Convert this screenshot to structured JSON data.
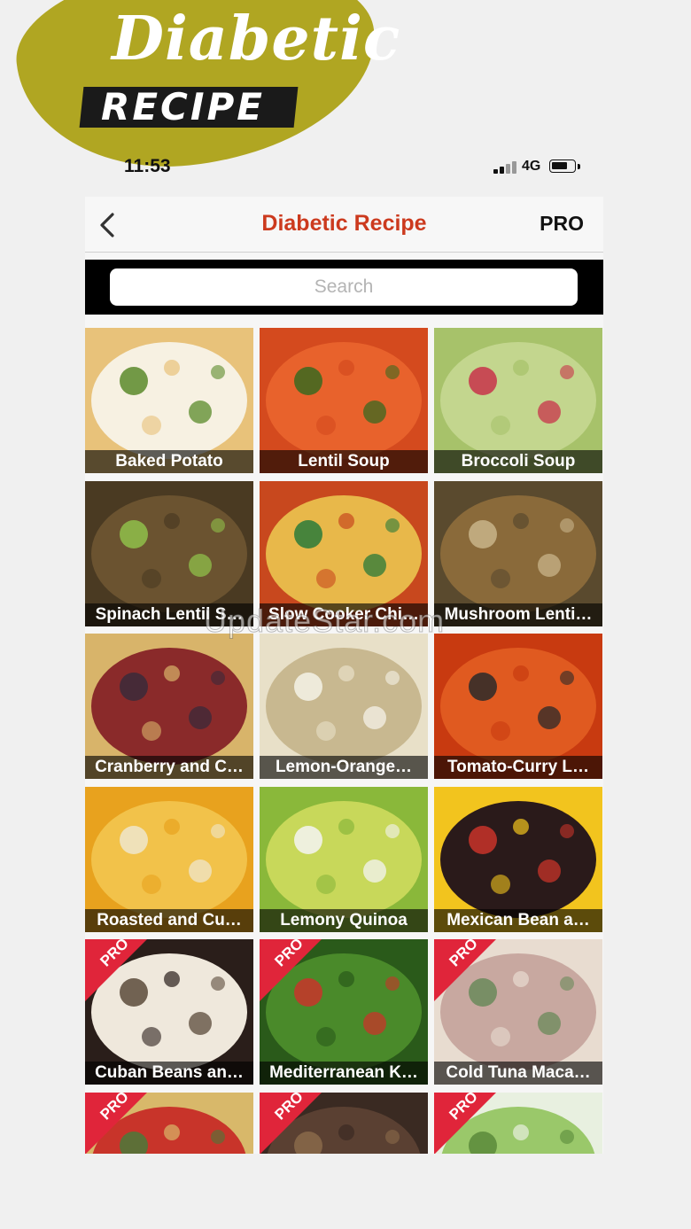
{
  "promo": {
    "script_word": "Diabetic",
    "bar_word": "RECIPE"
  },
  "status_bar": {
    "time": "11:53",
    "network": "4G"
  },
  "navbar": {
    "title": "Diabetic Recipe",
    "pro_label": "PRO"
  },
  "search": {
    "placeholder": "Search"
  },
  "pro_badge_text": "PRO",
  "watermark": "UpdateStar.com",
  "recipes": [
    {
      "label": "Baked Potato",
      "pro": false,
      "colors": [
        "#e8c27a",
        "#f7f1e2",
        "#5a8a2a"
      ]
    },
    {
      "label": "Lentil Soup",
      "pro": false,
      "colors": [
        "#d44a1e",
        "#e8622c",
        "#3a6a20"
      ]
    },
    {
      "label": "Broccoli Soup",
      "pro": false,
      "colors": [
        "#a7c26a",
        "#c3d68e",
        "#c8334a"
      ]
    },
    {
      "label": "Spinach Lentil S…",
      "pro": false,
      "colors": [
        "#4a3a22",
        "#6b5330",
        "#8fbf4a"
      ]
    },
    {
      "label": "Slow Cooker Chi…",
      "pro": false,
      "colors": [
        "#c8481e",
        "#e8b84a",
        "#2a7a3a"
      ]
    },
    {
      "label": "Mushroom Lenti…",
      "pro": false,
      "colors": [
        "#5a4a2e",
        "#8a6a3a",
        "#c8b48a"
      ]
    },
    {
      "label": "Cranberry and C…",
      "pro": false,
      "colors": [
        "#d8b46a",
        "#8a2a2a",
        "#3a2a3a"
      ]
    },
    {
      "label": "Lemon-Orange…",
      "pro": false,
      "colors": [
        "#e8e0c8",
        "#c8b890",
        "#f5f2e8"
      ]
    },
    {
      "label": "Tomato-Curry L…",
      "pro": false,
      "colors": [
        "#c83a10",
        "#e05a20",
        "#2a2a2a"
      ]
    },
    {
      "label": "Roasted and Cu…",
      "pro": false,
      "colors": [
        "#e8a21e",
        "#f2c24a",
        "#efe6cc"
      ]
    },
    {
      "label": "Lemony Quinoa",
      "pro": false,
      "colors": [
        "#8ab83a",
        "#c8d85a",
        "#f4f4f4"
      ]
    },
    {
      "label": "Mexican Bean a…",
      "pro": false,
      "colors": [
        "#f2c41e",
        "#2a1a1a",
        "#c8342a"
      ]
    },
    {
      "label": "Cuban Beans an…",
      "pro": true,
      "colors": [
        "#2a1e1a",
        "#efe8dc",
        "#5a4a3a"
      ]
    },
    {
      "label": "Mediterranean K…",
      "pro": true,
      "colors": [
        "#2a5a1a",
        "#4a8a2a",
        "#c8342a"
      ]
    },
    {
      "label": "Cold Tuna Maca…",
      "pro": true,
      "colors": [
        "#e8dcd0",
        "#c8a8a0",
        "#6a8a5a"
      ]
    },
    {
      "label": "",
      "pro": true,
      "colors": [
        "#d8b86a",
        "#c8342a",
        "#4a7a3a"
      ]
    },
    {
      "label": "",
      "pro": true,
      "colors": [
        "#3a2a22",
        "#5a4032",
        "#8a6a4a"
      ]
    },
    {
      "label": "",
      "pro": true,
      "colors": [
        "#e8f0e0",
        "#9ac86a",
        "#5a8a3a"
      ]
    }
  ]
}
